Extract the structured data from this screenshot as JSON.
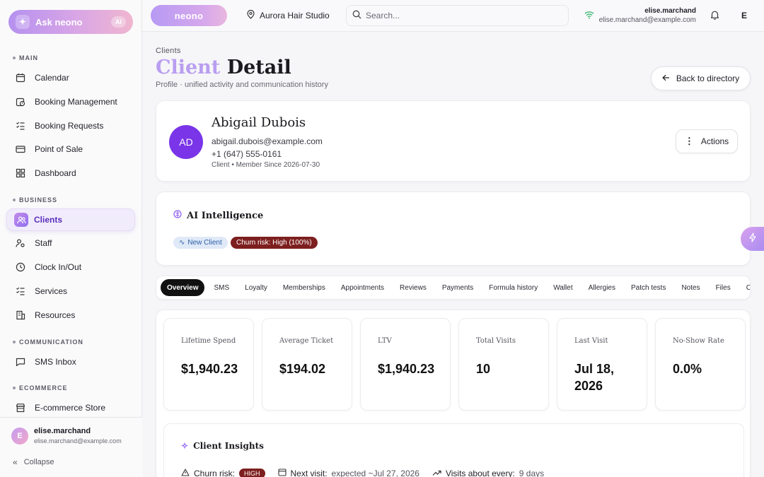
{
  "sidebar": {
    "ask_label": "Ask neono",
    "ask_badge": "AI",
    "sections": [
      {
        "label": "MAIN",
        "items": [
          {
            "label": "Calendar",
            "icon": "calendar-icon"
          },
          {
            "label": "Booking Management",
            "icon": "calendar-clock-icon"
          },
          {
            "label": "Booking Requests",
            "icon": "checklist-icon"
          },
          {
            "label": "Point of Sale",
            "icon": "card-icon"
          },
          {
            "label": "Dashboard",
            "icon": "grid-icon"
          }
        ]
      },
      {
        "label": "BUSINESS",
        "items": [
          {
            "label": "Clients",
            "icon": "users-icon",
            "active": true
          },
          {
            "label": "Staff",
            "icon": "user-gear-icon"
          },
          {
            "label": "Clock In/Out",
            "icon": "clock-icon"
          },
          {
            "label": "Services",
            "icon": "list-check-icon"
          },
          {
            "label": "Resources",
            "icon": "building-icon"
          }
        ]
      },
      {
        "label": "COMMUNICATION",
        "items": [
          {
            "label": "SMS Inbox",
            "icon": "message-icon"
          }
        ]
      },
      {
        "label": "ECOMMERCE",
        "items": [
          {
            "label": "E-commerce Store",
            "icon": "store-icon"
          }
        ]
      }
    ],
    "user": {
      "initial": "E",
      "name": "elise.marchand",
      "email": "elise.marchand@example.com"
    },
    "collapse_label": "Collapse"
  },
  "topbar": {
    "brand": "neono",
    "studio": "Aurora Hair Studio",
    "search_placeholder": "Search...",
    "user_name": "elise.marchand",
    "user_email": "elise.marchand@example.com",
    "avatar_initial": "E"
  },
  "page": {
    "breadcrumb": "Clients",
    "title_accent": "Client",
    "title_rest": " Detail",
    "subtitle": "Profile · unified activity and communication history",
    "back_label": "Back to directory"
  },
  "client": {
    "initials": "AD",
    "name": "Abigail Dubois",
    "email": "abigail.dubois@example.com",
    "phone": "+1 (647) 555-0161",
    "meta": "Client • Member Since 2026-07-30",
    "actions_label": "Actions"
  },
  "ai": {
    "title": "AI Intelligence",
    "chip_new": "New Client",
    "chip_risk": "Churn risk: High (100%)"
  },
  "tabs": [
    "Overview",
    "SMS",
    "Loyalty",
    "Memberships",
    "Appointments",
    "Reviews",
    "Payments",
    "Formula history",
    "Wallet",
    "Allergies",
    "Patch tests",
    "Notes",
    "Files",
    "Con"
  ],
  "active_tab": "Overview",
  "stats": [
    {
      "label": "Lifetime Spend",
      "value": "$1,940.23"
    },
    {
      "label": "Average Ticket",
      "value": "$194.02"
    },
    {
      "label": "LTV",
      "value": "$1,940.23"
    },
    {
      "label": "Total Visits",
      "value": "10"
    },
    {
      "label": "Last Visit",
      "value": "Jul 18, 2026"
    },
    {
      "label": "No-Show Rate",
      "value": "0.0%"
    }
  ],
  "insights": {
    "title": "Client Insights",
    "churn_label": "Churn risk:",
    "churn_badge": "HIGH",
    "next_label": "Next visit:",
    "next_value": "expected ~Jul 27, 2026",
    "freq_label": "Visits about every:",
    "freq_value": "9 days"
  },
  "colors": {
    "accent": "#7a35e8",
    "danger": "#7d1f1f",
    "active_tab": "#111111"
  }
}
